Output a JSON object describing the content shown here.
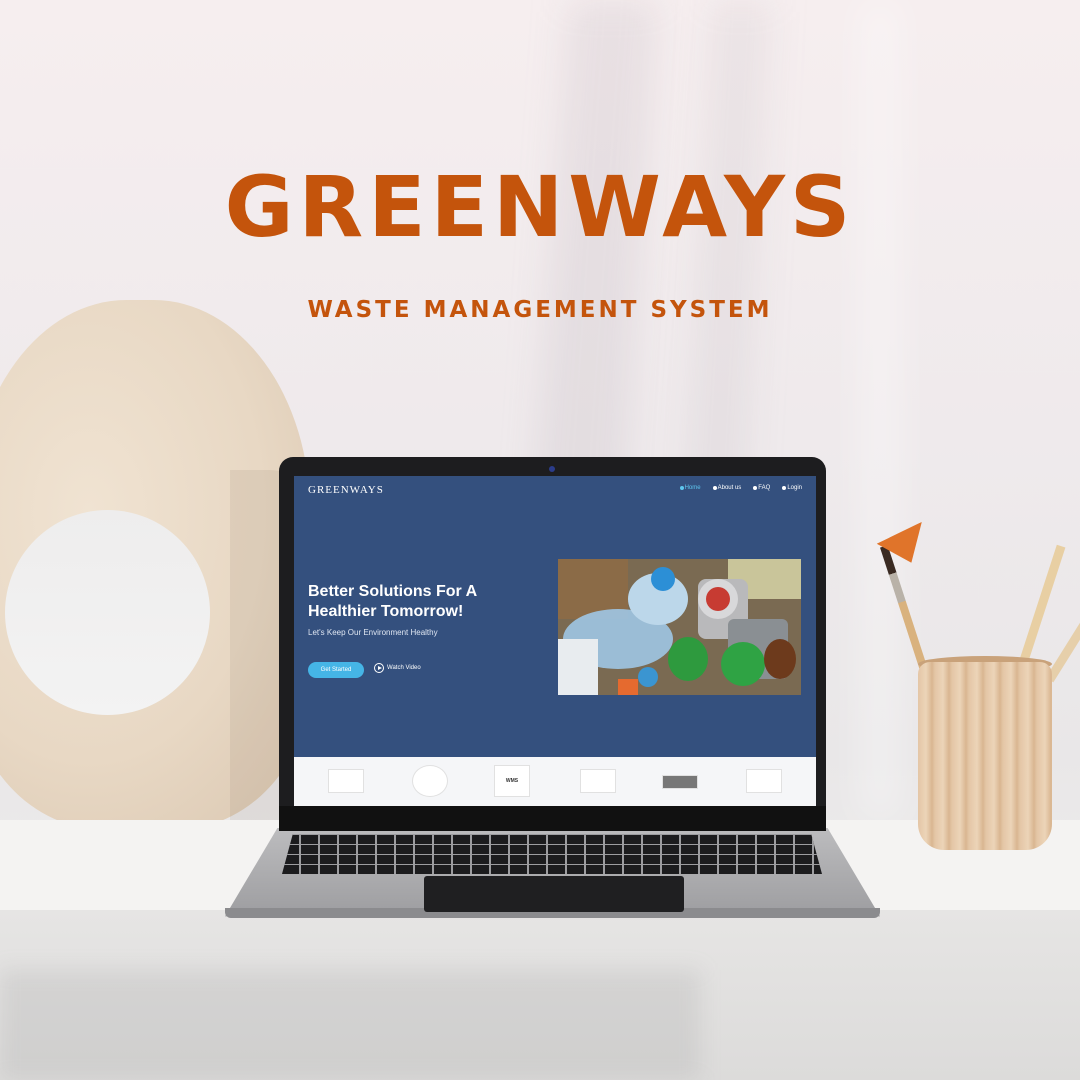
{
  "poster": {
    "title": "GREENWAYS",
    "subtitle": "WASTE MANAGEMENT SYSTEM"
  },
  "site": {
    "brand": "GREENWAYS",
    "nav": [
      {
        "label": "Home",
        "icon": "home-icon",
        "active": true
      },
      {
        "label": "About us",
        "icon": "info-icon",
        "active": false
      },
      {
        "label": "FAQ",
        "icon": "question-icon",
        "active": false
      },
      {
        "label": "Login",
        "icon": "login-icon",
        "active": false
      }
    ],
    "hero": {
      "title": "Better Solutions For A Healthier Tomorrow!",
      "subtitle": "Let's Keep Our Environment Healthy",
      "cta_label": "Get Started",
      "video_label": "Watch Video"
    },
    "logo_strip": {
      "wms_label": "WMS"
    }
  },
  "colors": {
    "brand_orange": "#c4540c",
    "site_bg": "#34507e",
    "accent_blue": "#45b5e6",
    "active_nav": "#5ec6ef"
  }
}
